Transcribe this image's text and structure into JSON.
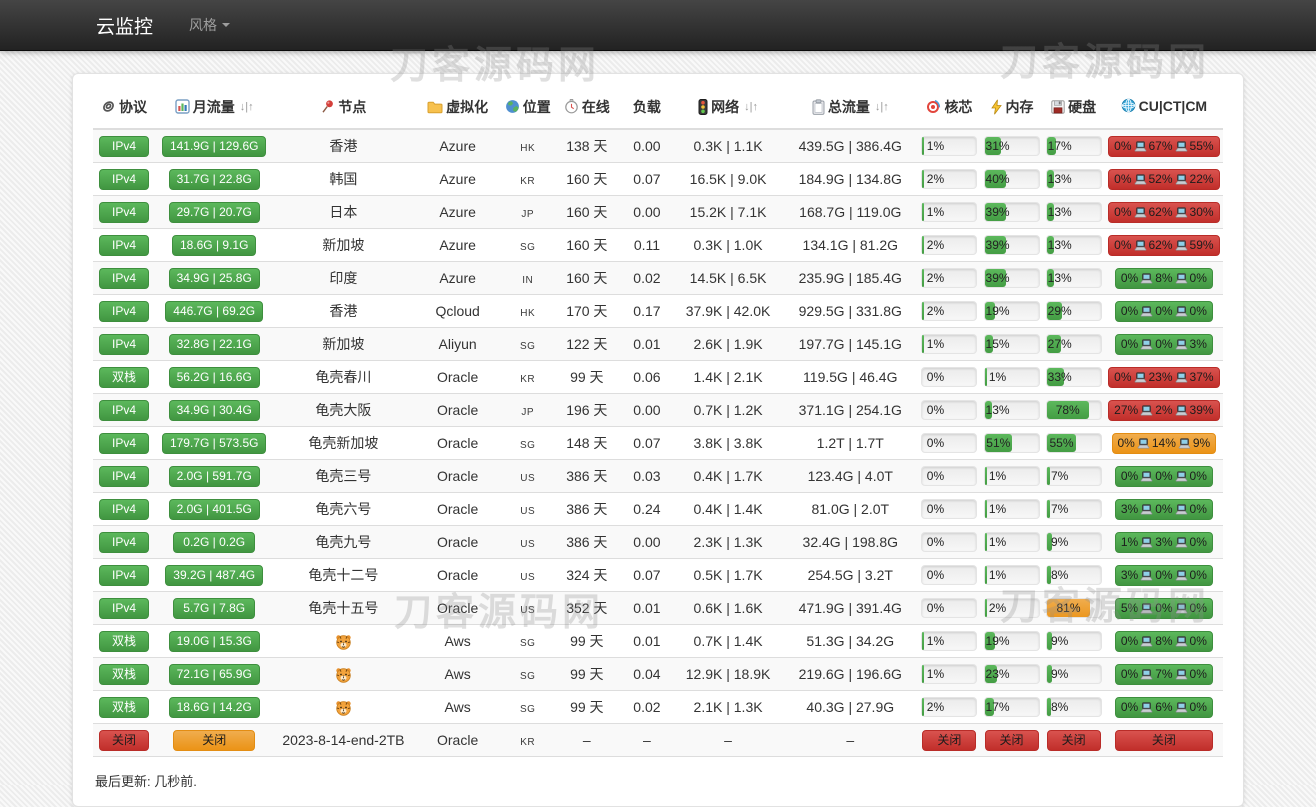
{
  "navbar": {
    "brand": "云监控",
    "style_menu": "风格"
  },
  "watermark_text": "刀客源码网",
  "footer": {
    "last_update": "最后更新: 几秒前."
  },
  "table": {
    "columns": [
      {
        "icon": "paperclip-icon",
        "label": "协议"
      },
      {
        "icon": "bar-chart-icon",
        "label": "月流量",
        "sort": "↓|↑"
      },
      {
        "icon": "pushpin-icon",
        "label": "节点"
      },
      {
        "icon": "folder-icon",
        "label": "虚拟化"
      },
      {
        "icon": "globe-icon",
        "label": "位置"
      },
      {
        "icon": "clock-icon",
        "label": "在线"
      },
      {
        "icon": null,
        "label": "负载"
      },
      {
        "icon": "traffic-light-icon",
        "label": "网络",
        "sort": "↓|↑"
      },
      {
        "icon": "clipboard-icon",
        "label": "总流量",
        "sort": "↓|↑"
      },
      {
        "icon": "target-icon",
        "label": "核芯"
      },
      {
        "icon": "lightning-icon",
        "label": "内存"
      },
      {
        "icon": "floppy-icon",
        "label": "硬盘"
      },
      {
        "icon": "globe-mesh-icon",
        "label": "CU|CT|CM"
      }
    ],
    "rows": [
      {
        "protocol": {
          "label": "IPv4",
          "color": "green"
        },
        "monthly": {
          "label": "141.9G | 129.6G",
          "color": "green"
        },
        "node": "香港",
        "virtualization": "Azure",
        "location": "HK",
        "online": "138 天",
        "load": "0.00",
        "network": "0.3K | 1.1K",
        "total": "439.5G | 386.4G",
        "cpu": {
          "pct": 1
        },
        "mem": {
          "pct": 31
        },
        "disk": {
          "pct": 17
        },
        "cucm": {
          "color": "red",
          "parts": [
            "0%",
            "67%",
            "55%"
          ]
        }
      },
      {
        "protocol": {
          "label": "IPv4",
          "color": "green"
        },
        "monthly": {
          "label": "31.7G | 22.8G",
          "color": "green"
        },
        "node": "韩国",
        "virtualization": "Azure",
        "location": "KR",
        "online": "160 天",
        "load": "0.07",
        "network": "16.5K | 9.0K",
        "total": "184.9G | 134.8G",
        "cpu": {
          "pct": 2
        },
        "mem": {
          "pct": 40
        },
        "disk": {
          "pct": 13
        },
        "cucm": {
          "color": "red",
          "parts": [
            "0%",
            "52%",
            "22%"
          ]
        }
      },
      {
        "protocol": {
          "label": "IPv4",
          "color": "green"
        },
        "monthly": {
          "label": "29.7G | 20.7G",
          "color": "green"
        },
        "node": "日本",
        "virtualization": "Azure",
        "location": "JP",
        "online": "160 天",
        "load": "0.00",
        "network": "15.2K | 7.1K",
        "total": "168.7G | 119.0G",
        "cpu": {
          "pct": 1
        },
        "mem": {
          "pct": 39
        },
        "disk": {
          "pct": 13
        },
        "cucm": {
          "color": "red",
          "parts": [
            "0%",
            "62%",
            "30%"
          ]
        }
      },
      {
        "protocol": {
          "label": "IPv4",
          "color": "green"
        },
        "monthly": {
          "label": "18.6G | 9.1G",
          "color": "green"
        },
        "node": "新加坡",
        "virtualization": "Azure",
        "location": "SG",
        "online": "160 天",
        "load": "0.11",
        "network": "0.3K | 1.0K",
        "total": "134.1G | 81.2G",
        "cpu": {
          "pct": 2
        },
        "mem": {
          "pct": 39
        },
        "disk": {
          "pct": 13
        },
        "cucm": {
          "color": "red",
          "parts": [
            "0%",
            "62%",
            "59%"
          ]
        }
      },
      {
        "protocol": {
          "label": "IPv4",
          "color": "green"
        },
        "monthly": {
          "label": "34.9G | 25.8G",
          "color": "green"
        },
        "node": "印度",
        "virtualization": "Azure",
        "location": "IN",
        "online": "160 天",
        "load": "0.02",
        "network": "14.5K | 6.5K",
        "total": "235.9G | 185.4G",
        "cpu": {
          "pct": 2
        },
        "mem": {
          "pct": 39
        },
        "disk": {
          "pct": 13
        },
        "cucm": {
          "color": "green",
          "parts": [
            "0%",
            "8%",
            "0%"
          ]
        }
      },
      {
        "protocol": {
          "label": "IPv4",
          "color": "green"
        },
        "monthly": {
          "label": "446.7G | 69.2G",
          "color": "green"
        },
        "node": "香港",
        "virtualization": "Qcloud",
        "location": "HK",
        "online": "170 天",
        "load": "0.17",
        "network": "37.9K | 42.0K",
        "total": "929.5G | 331.8G",
        "cpu": {
          "pct": 2
        },
        "mem": {
          "pct": 19
        },
        "disk": {
          "pct": 29
        },
        "cucm": {
          "color": "green",
          "parts": [
            "0%",
            "0%",
            "0%"
          ]
        }
      },
      {
        "protocol": {
          "label": "IPv4",
          "color": "green"
        },
        "monthly": {
          "label": "32.8G | 22.1G",
          "color": "green"
        },
        "node": "新加坡",
        "virtualization": "Aliyun",
        "location": "SG",
        "online": "122 天",
        "load": "0.01",
        "network": "2.6K | 1.9K",
        "total": "197.7G | 145.1G",
        "cpu": {
          "pct": 1
        },
        "mem": {
          "pct": 15
        },
        "disk": {
          "pct": 27
        },
        "cucm": {
          "color": "green",
          "parts": [
            "0%",
            "0%",
            "3%"
          ]
        }
      },
      {
        "protocol": {
          "label": "双栈",
          "color": "green"
        },
        "monthly": {
          "label": "56.2G | 16.6G",
          "color": "green"
        },
        "node": "龟壳春川",
        "virtualization": "Oracle",
        "location": "KR",
        "online": "99 天",
        "load": "0.06",
        "network": "1.4K | 2.1K",
        "total": "119.5G | 46.4G",
        "cpu": {
          "pct": 0
        },
        "mem": {
          "pct": 1
        },
        "disk": {
          "pct": 33
        },
        "cucm": {
          "color": "red",
          "parts": [
            "0%",
            "23%",
            "37%"
          ]
        }
      },
      {
        "protocol": {
          "label": "IPv4",
          "color": "green"
        },
        "monthly": {
          "label": "34.9G | 30.4G",
          "color": "green"
        },
        "node": "龟壳大阪",
        "virtualization": "Oracle",
        "location": "JP",
        "online": "196 天",
        "load": "0.00",
        "network": "0.7K | 1.2K",
        "total": "371.1G | 254.1G",
        "cpu": {
          "pct": 0
        },
        "mem": {
          "pct": 13
        },
        "disk": {
          "pct": 78
        },
        "cucm": {
          "color": "red",
          "parts": [
            "27%",
            "2%",
            "39%"
          ]
        }
      },
      {
        "protocol": {
          "label": "IPv4",
          "color": "green"
        },
        "monthly": {
          "label": "179.7G | 573.5G",
          "color": "green"
        },
        "node": "龟壳新加坡",
        "virtualization": "Oracle",
        "location": "SG",
        "online": "148 天",
        "load": "0.07",
        "network": "3.8K | 3.8K",
        "total": "1.2T | 1.7T",
        "cpu": {
          "pct": 0
        },
        "mem": {
          "pct": 51
        },
        "disk": {
          "pct": 55
        },
        "cucm": {
          "color": "orange",
          "parts": [
            "0%",
            "14%",
            "9%"
          ]
        }
      },
      {
        "protocol": {
          "label": "IPv4",
          "color": "green"
        },
        "monthly": {
          "label": "2.0G | 591.7G",
          "color": "green"
        },
        "node": "龟壳三号",
        "virtualization": "Oracle",
        "location": "US",
        "online": "386 天",
        "load": "0.03",
        "network": "0.4K | 1.7K",
        "total": "123.4G | 4.0T",
        "cpu": {
          "pct": 0
        },
        "mem": {
          "pct": 1
        },
        "disk": {
          "pct": 7
        },
        "cucm": {
          "color": "green",
          "parts": [
            "0%",
            "0%",
            "0%"
          ]
        }
      },
      {
        "protocol": {
          "label": "IPv4",
          "color": "green"
        },
        "monthly": {
          "label": "2.0G | 401.5G",
          "color": "green"
        },
        "node": "龟壳六号",
        "virtualization": "Oracle",
        "location": "US",
        "online": "386 天",
        "load": "0.24",
        "network": "0.4K | 1.4K",
        "total": "81.0G | 2.0T",
        "cpu": {
          "pct": 0
        },
        "mem": {
          "pct": 1
        },
        "disk": {
          "pct": 7
        },
        "cucm": {
          "color": "green",
          "parts": [
            "3%",
            "0%",
            "0%"
          ]
        }
      },
      {
        "protocol": {
          "label": "IPv4",
          "color": "green"
        },
        "monthly": {
          "label": "0.2G | 0.2G",
          "color": "green"
        },
        "node": "龟壳九号",
        "virtualization": "Oracle",
        "location": "US",
        "online": "386 天",
        "load": "0.00",
        "network": "2.3K | 1.3K",
        "total": "32.4G | 198.8G",
        "cpu": {
          "pct": 0
        },
        "mem": {
          "pct": 1
        },
        "disk": {
          "pct": 9
        },
        "cucm": {
          "color": "green",
          "parts": [
            "1%",
            "3%",
            "0%"
          ]
        }
      },
      {
        "protocol": {
          "label": "IPv4",
          "color": "green"
        },
        "monthly": {
          "label": "39.2G | 487.4G",
          "color": "green"
        },
        "node": "龟壳十二号",
        "virtualization": "Oracle",
        "location": "US",
        "online": "324 天",
        "load": "0.07",
        "network": "0.5K | 1.7K",
        "total": "254.5G | 3.2T",
        "cpu": {
          "pct": 0
        },
        "mem": {
          "pct": 1
        },
        "disk": {
          "pct": 8
        },
        "cucm": {
          "color": "green",
          "parts": [
            "3%",
            "0%",
            "0%"
          ]
        }
      },
      {
        "protocol": {
          "label": "IPv4",
          "color": "green"
        },
        "monthly": {
          "label": "5.7G | 7.8G",
          "color": "green"
        },
        "node": "龟壳十五号",
        "virtualization": "Oracle",
        "location": "US",
        "online": "352 天",
        "load": "0.01",
        "network": "0.6K | 1.6K",
        "total": "471.9G | 391.4G",
        "cpu": {
          "pct": 0
        },
        "mem": {
          "pct": 2
        },
        "disk": {
          "pct": 81,
          "warn": true
        },
        "cucm": {
          "color": "green",
          "parts": [
            "5%",
            "0%",
            "0%"
          ]
        }
      },
      {
        "protocol": {
          "label": "双栈",
          "color": "green"
        },
        "monthly": {
          "label": "19.0G | 15.3G",
          "color": "green"
        },
        "node": "🐯",
        "virtualization": "Aws",
        "location": "SG",
        "online": "99 天",
        "load": "0.01",
        "network": "0.7K | 1.4K",
        "total": "51.3G | 34.2G",
        "cpu": {
          "pct": 1
        },
        "mem": {
          "pct": 19
        },
        "disk": {
          "pct": 9
        },
        "cucm": {
          "color": "green",
          "parts": [
            "0%",
            "8%",
            "0%"
          ]
        }
      },
      {
        "protocol": {
          "label": "双栈",
          "color": "green"
        },
        "monthly": {
          "label": "72.1G | 65.9G",
          "color": "green"
        },
        "node": "🐯",
        "virtualization": "Aws",
        "location": "SG",
        "online": "99 天",
        "load": "0.04",
        "network": "12.9K | 18.9K",
        "total": "219.6G | 196.6G",
        "cpu": {
          "pct": 1
        },
        "mem": {
          "pct": 23
        },
        "disk": {
          "pct": 9
        },
        "cucm": {
          "color": "green",
          "parts": [
            "0%",
            "7%",
            "0%"
          ]
        }
      },
      {
        "protocol": {
          "label": "双栈",
          "color": "green"
        },
        "monthly": {
          "label": "18.6G | 14.2G",
          "color": "green"
        },
        "node": "🐯",
        "virtualization": "Aws",
        "location": "SG",
        "online": "99 天",
        "load": "0.02",
        "network": "2.1K | 1.3K",
        "total": "40.3G | 27.9G",
        "cpu": {
          "pct": 2
        },
        "mem": {
          "pct": 17
        },
        "disk": {
          "pct": 8
        },
        "cucm": {
          "color": "green",
          "parts": [
            "0%",
            "6%",
            "0%"
          ]
        }
      },
      {
        "protocol": {
          "label": "关闭",
          "color": "red"
        },
        "monthly": {
          "label": "关闭",
          "color": "orange"
        },
        "node": "2023-8-14-end-2TB",
        "virtualization": "Oracle",
        "location": "KR",
        "online": "–",
        "load": "–",
        "network": "–",
        "total": "–",
        "cpu": {
          "closed": "关闭"
        },
        "mem": {
          "closed": "关闭"
        },
        "disk": {
          "closed": "关闭"
        },
        "cucm": {
          "closed": "关闭",
          "color": "red"
        }
      }
    ]
  }
}
